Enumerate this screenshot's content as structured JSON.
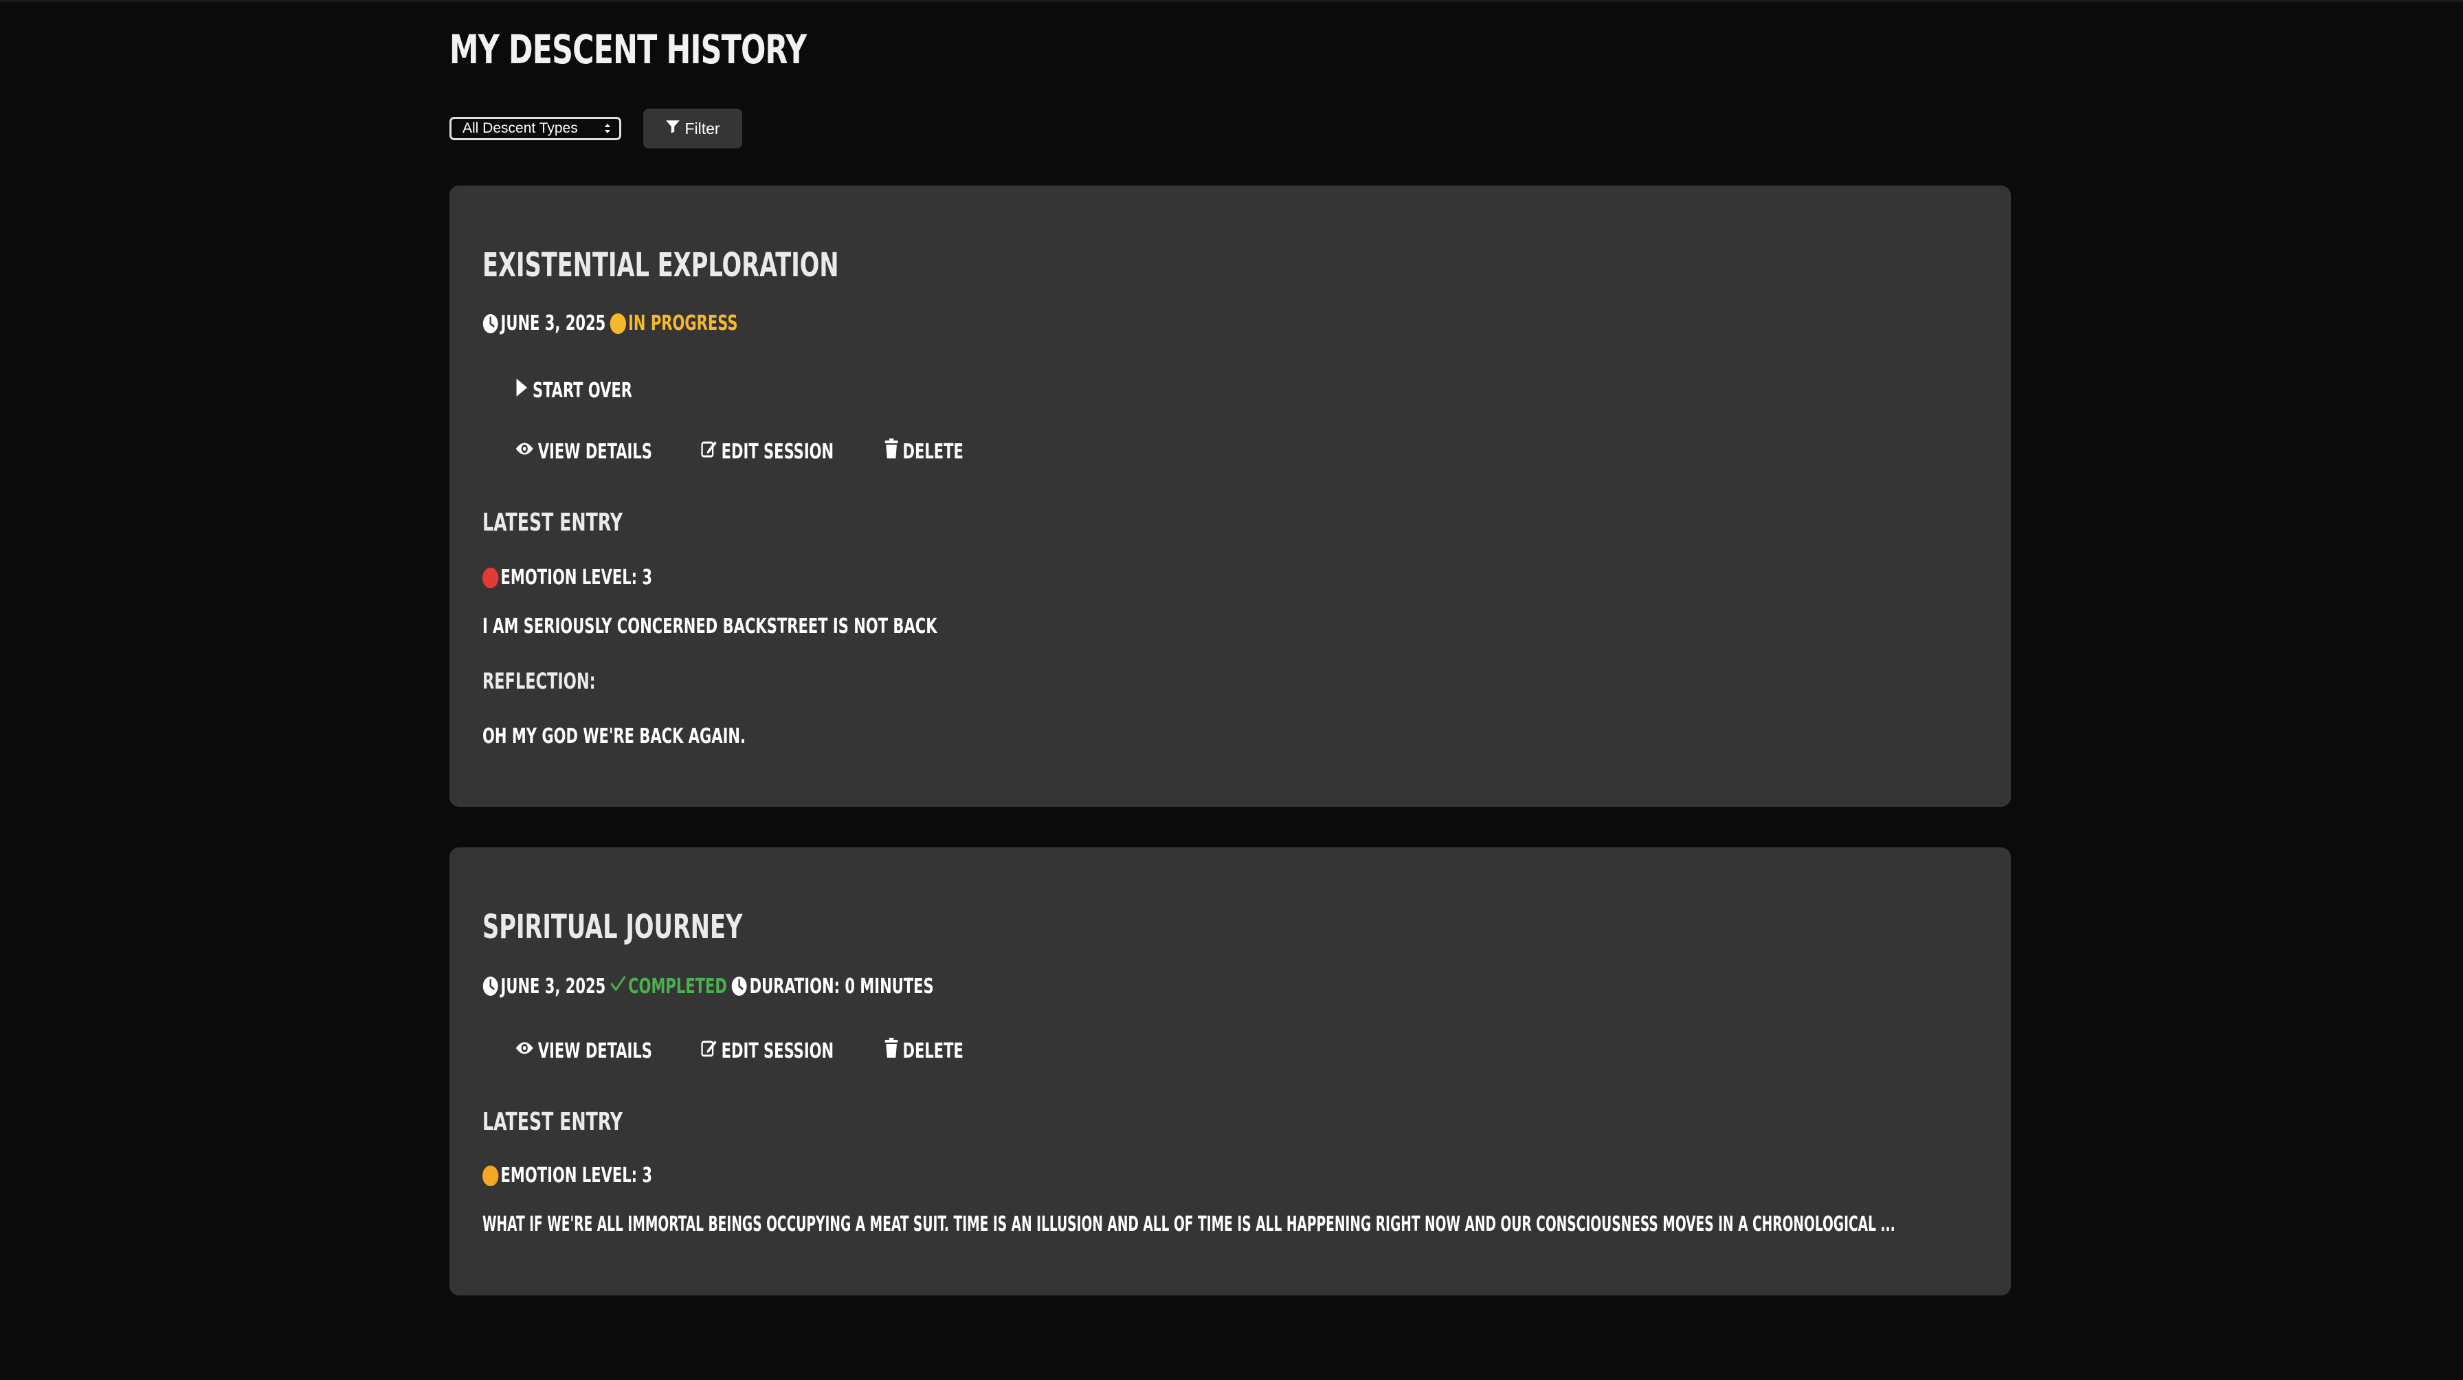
{
  "page": {
    "title": "MY DESCENT HISTORY"
  },
  "filters": {
    "select_value": "All Descent Types",
    "filter_label": "Filter"
  },
  "colors": {
    "background": "#0b0b0b",
    "card": "#353535",
    "in_progress": "#f6b92b",
    "completed": "#4caf50",
    "emotion_red": "#e53935",
    "emotion_orange": "#f5a623"
  },
  "sessions": [
    {
      "title": "EXISTENTIAL EXPLORATION",
      "date": "JUNE 3, 2025",
      "status": "IN PROGRESS",
      "start_over_label": "START OVER",
      "view_details_label": "VIEW DETAILS",
      "edit_session_label": "EDIT SESSION",
      "delete_label": "DELETE",
      "latest_entry_heading": "LATEST ENTRY",
      "emotion_label": "EMOTION LEVEL: 3",
      "entry_text": "I AM SERIOUSLY CONCERNED BACKSTREET IS NOT BACK",
      "reflection_heading": "REFLECTION:",
      "reflection_text": "OH MY GOD WE'RE BACK AGAIN."
    },
    {
      "title": "SPIRITUAL JOURNEY",
      "date": "JUNE 3, 2025",
      "status": "COMPLETED",
      "duration": "DURATION: 0 MINUTES",
      "view_details_label": "VIEW DETAILS",
      "edit_session_label": "EDIT SESSION",
      "delete_label": "DELETE",
      "latest_entry_heading": "LATEST ENTRY",
      "emotion_label": "EMOTION LEVEL: 3",
      "entry_text": "WHAT IF WE'RE ALL IMMORTAL BEINGS OCCUPYING A MEAT SUIT. TIME IS AN ILLUSION AND ALL OF TIME IS ALL HAPPENING RIGHT NOW AND OUR CONSCIOUSNESS MOVES IN A CHRONOLOGICAL ..."
    }
  ]
}
